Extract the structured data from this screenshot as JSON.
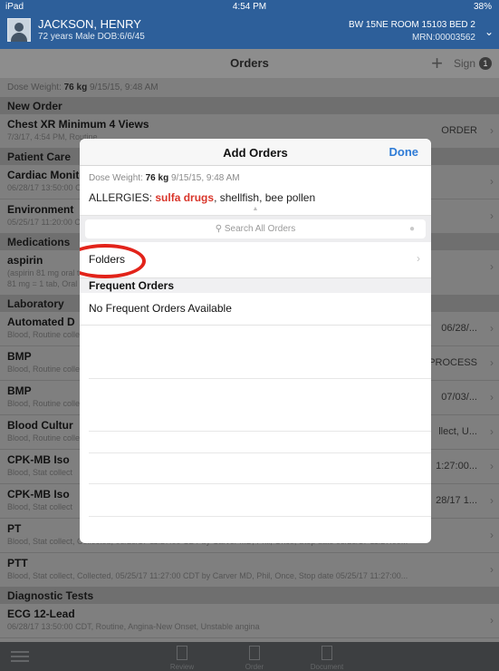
{
  "status_bar": {
    "device": "iPad",
    "time": "4:54 PM",
    "battery": "38%"
  },
  "patient": {
    "name": "JACKSON, HENRY",
    "info": "72 years  Male  DOB:6/6/45",
    "room": "BW 15NE ROOM 15103 BED 2",
    "mrn": "MRN:00003562"
  },
  "orders_nav": {
    "title": "Orders",
    "sign_label": "Sign",
    "sign_count": "1"
  },
  "dose": {
    "label": "Dose Weight:",
    "value": "76 kg",
    "timestamp": "9/15/15, 9:48 AM"
  },
  "background": {
    "sections": [
      {
        "name": "New Order"
      },
      {
        "name": "Patient Care"
      },
      {
        "name": "Medications"
      },
      {
        "name": "Laboratory"
      },
      {
        "name": "Diagnostic Tests"
      }
    ],
    "new_order": {
      "title": "Chest XR Minimum 4 Views",
      "sub": "7/3/17, 4:54 PM, Routine",
      "action": "ORDER"
    },
    "patient_care": [
      {
        "title": "Cardiac Monitor",
        "sub": "06/28/17 13:50:00 CDT"
      },
      {
        "title": "Environment",
        "sub": "05/25/17 11:20:00 CDT"
      }
    ],
    "medication": {
      "title": "aspirin",
      "sub1": "(aspirin 81 mg oral tablet)",
      "sub2": "81 mg = 1 tab, Oral"
    },
    "laboratory": [
      {
        "title": "Automated D",
        "sub": "Blood, Routine collect",
        "right": "06/28/..."
      },
      {
        "title": "BMP",
        "sub": "Blood, Routine collect",
        "right": "PROCESS"
      },
      {
        "title": "BMP",
        "sub": "Blood, Routine collect",
        "right": "07/03/..."
      },
      {
        "title": "Blood Cultur",
        "sub": "Blood, Routine collect",
        "right": "llect, U..."
      },
      {
        "title": "CPK-MB Iso",
        "sub": "Blood, Stat collect",
        "right": "1:27:00..."
      },
      {
        "title": "CPK-MB Iso",
        "sub": "Blood, Stat collect",
        "right": "28/17 1..."
      },
      {
        "title": "PT",
        "sub": "Blood, Stat collect, Collected, 05/25/17 11:27:00 CDT by Carver MD, Phil, Once, Stop date 05/25/17 11:27:00...",
        "right": ""
      },
      {
        "title": "PTT",
        "sub": "Blood, Stat collect, Collected, 05/25/17 11:27:00 CDT by Carver MD, Phil, Once, Stop date 05/25/17 11:27:00...",
        "right": ""
      }
    ],
    "diagnostic": {
      "title": "ECG 12-Lead",
      "sub": "06/28/17 13:50:00 CDT, Routine, Angina-New Onset, Unstable angina"
    }
  },
  "tabbar": {
    "tabs": [
      "Review",
      "Order",
      "Document"
    ]
  },
  "modal": {
    "title": "Add Orders",
    "done_label": "Done",
    "allergies_label": "ALLERGIES:",
    "allergy_primary": "sulfa drugs",
    "allergy_rest": ", shellfish, bee pollen",
    "search_placeholder": "Search All Orders",
    "folders_label": "Folders",
    "frequent_header": "Frequent Orders",
    "no_frequent": "No Frequent Orders Available"
  },
  "colors": {
    "header_blue": "#2d5f9a",
    "accent_blue": "#2e7bd6",
    "allergy_red": "#d9362b",
    "highlight_circle": "#e2231a"
  }
}
